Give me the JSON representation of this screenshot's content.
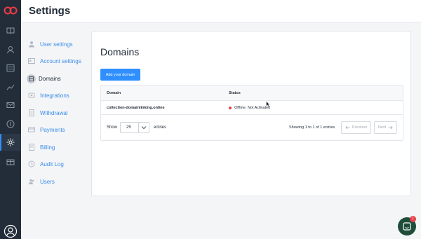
{
  "header": {
    "title": "Settings"
  },
  "nav": {
    "items": [
      {
        "label": "User settings",
        "icon": "user-icon"
      },
      {
        "label": "Account settings",
        "icon": "id-card-icon"
      },
      {
        "label": "Domains",
        "icon": "domain-icon",
        "active": true
      },
      {
        "label": "Integrations",
        "icon": "integrations-icon"
      },
      {
        "label": "Withdrawal",
        "icon": "document-icon"
      },
      {
        "label": "Payments",
        "icon": "credit-card-icon"
      },
      {
        "label": "Billing",
        "icon": "billing-icon"
      },
      {
        "label": "Audit Log",
        "icon": "clock-icon"
      },
      {
        "label": "Users",
        "icon": "users-icon"
      }
    ]
  },
  "main": {
    "title": "Domains",
    "add_button": "Add your domain",
    "table": {
      "columns": [
        "Domain",
        "Status"
      ],
      "rows": [
        {
          "domain": "collection-domainlinking.online",
          "status": "Offline. Not Activated"
        }
      ]
    },
    "footer": {
      "show_label": "Show",
      "page_size": "25",
      "entries_label": "entries",
      "showing_text": "Showing 1 to 1 of 1 entries",
      "previous_label": "Previous",
      "next_label": "Next"
    }
  },
  "chat": {
    "badge_count": "1"
  },
  "colors": {
    "accent": "#2f8fff",
    "rail": "#232d3a",
    "status_offline": "#e5414b",
    "chat": "#1e4d3a"
  }
}
